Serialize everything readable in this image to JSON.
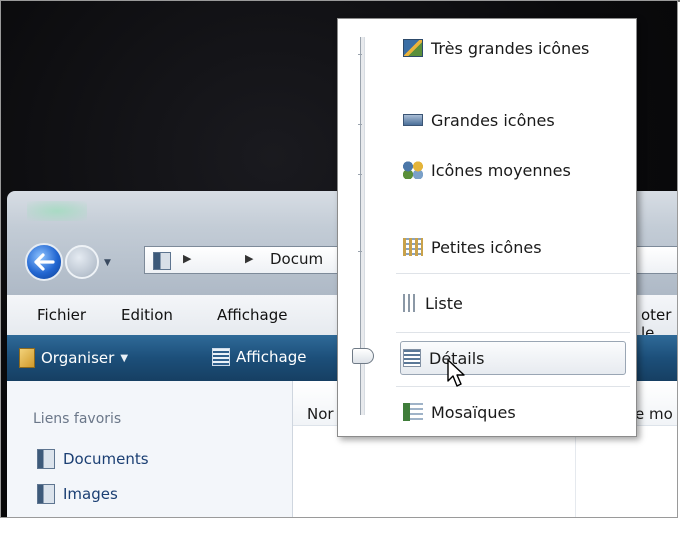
{
  "explorer": {
    "address_breadcrumb": "Docum",
    "menu": [
      "Fichier",
      "Edition",
      "Affichage",
      "oter le"
    ],
    "toolbar": {
      "organize": "Organiser",
      "view": "Affichage"
    },
    "left_pane": {
      "title": "Liens favoris",
      "items": [
        "Documents",
        "Images"
      ]
    },
    "columns": [
      "Nor",
      "e mo"
    ]
  },
  "view_menu": {
    "options": [
      {
        "label": "Très grandes icônes",
        "icon": "extra-large-icons-icon"
      },
      {
        "label": "Grandes icônes",
        "icon": "large-icons-icon"
      },
      {
        "label": "Icônes moyennes",
        "icon": "medium-icons-icon"
      },
      {
        "label": "Petites icônes",
        "icon": "small-icons-icon"
      },
      {
        "label": "Liste",
        "icon": "list-icon"
      },
      {
        "label": "Détails",
        "icon": "details-icon",
        "selected": true
      },
      {
        "label": "Mosaïques",
        "icon": "tiles-icon"
      }
    ]
  },
  "colors": {
    "toolbar": "#1c4f7a",
    "link": "#1b3f73",
    "menu_border": "#8b8b8b"
  }
}
